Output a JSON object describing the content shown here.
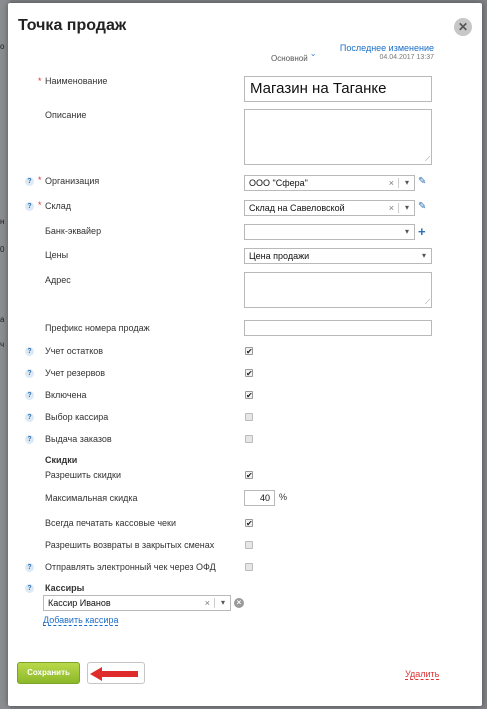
{
  "dialog": {
    "title": "Точка продаж",
    "close_glyph": "✕",
    "version_label": "Основной",
    "last_change_label": "Последнее изменение",
    "last_change_date": "04.04.2017 13:37"
  },
  "background": {
    "bits": [
      "о",
      "н",
      "0",
      "а",
      "ч"
    ]
  },
  "fields": {
    "name": {
      "label": "Наименование",
      "value": "Магазин на Таганке"
    },
    "description": {
      "label": "Описание",
      "value": ""
    },
    "organization": {
      "label": "Организация",
      "value": "ООО \"Сфера\""
    },
    "warehouse": {
      "label": "Склад",
      "value": "Склад на Савеловской"
    },
    "bank": {
      "label": "Банк-эквайер",
      "value": ""
    },
    "prices": {
      "label": "Цены",
      "value": "Цена продажи"
    },
    "address": {
      "label": "Адрес",
      "value": ""
    },
    "prefix": {
      "label": "Префикс номера продаж",
      "value": ""
    }
  },
  "checkboxes": [
    {
      "label": "Учет остатков",
      "checked": true,
      "help": true
    },
    {
      "label": "Учет резервов",
      "checked": true,
      "help": true
    },
    {
      "label": "Включена",
      "checked": true,
      "help": true
    },
    {
      "label": "Выбор кассира",
      "checked": false,
      "help": true
    },
    {
      "label": "Выдача заказов",
      "checked": false,
      "help": true
    }
  ],
  "discounts": {
    "heading": "Скидки",
    "allow_label": "Разрешить скидки",
    "allow_checked": true,
    "max_label": "Максимальная скидка",
    "max_value": "40",
    "max_unit": "%"
  },
  "receipts": [
    {
      "label": "Всегда печатать кассовые чеки",
      "checked": true,
      "help": false
    },
    {
      "label": "Разрешить возвраты в закрытых сменах",
      "checked": false,
      "help": false
    },
    {
      "label": "Отправлять электронный чек через ОФД",
      "checked": false,
      "help": true
    }
  ],
  "cashiers": {
    "heading": "Кассиры",
    "items": [
      "Кассир Иванов"
    ],
    "add_label": "Добавить кассира"
  },
  "footer": {
    "save_label": "Сохранить",
    "cancel_label": "",
    "delete_label": "Удалить"
  },
  "icons": {
    "help": "?",
    "required": "*",
    "clear": "×",
    "dropdown": "▾",
    "edit": "✎",
    "add": "+",
    "check": "✔",
    "remove": "×",
    "chevron": "⌄",
    "resize_grip": "⟋"
  },
  "colors": {
    "accent": "#1a6ec7",
    "save_button": "#9cc43a",
    "delete": "#d33333",
    "arrow": "#e02b2b"
  }
}
